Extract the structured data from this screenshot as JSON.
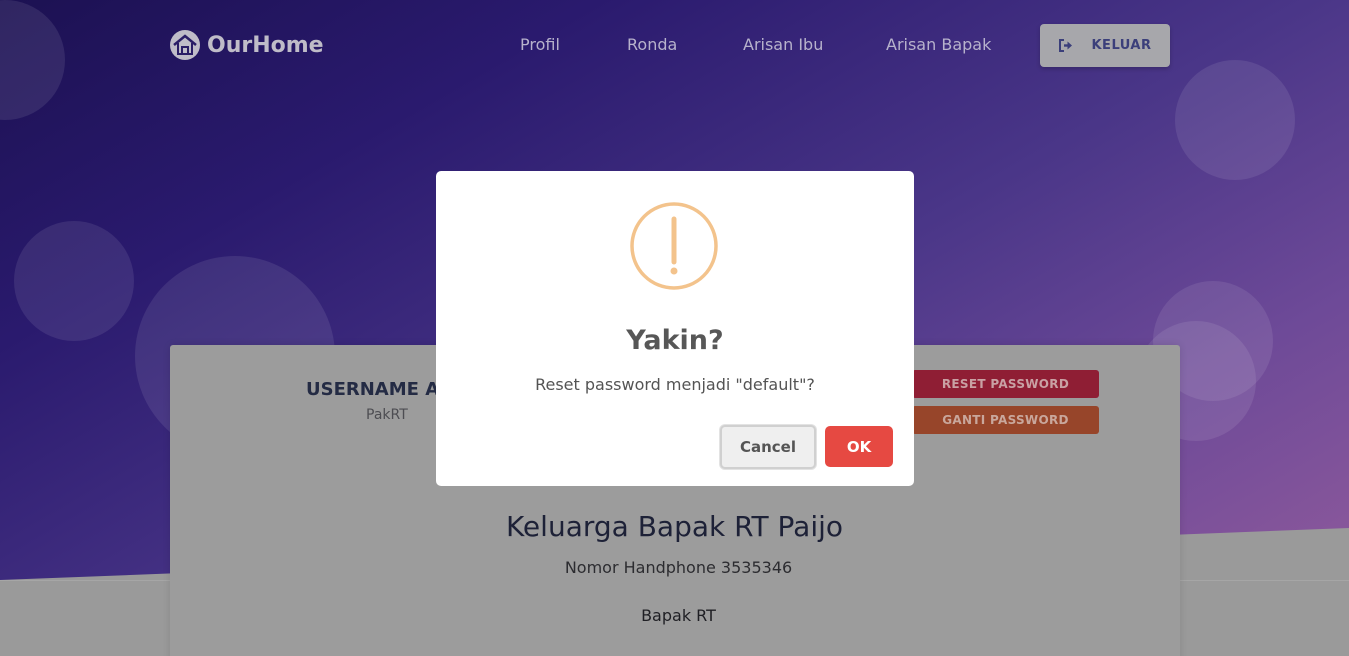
{
  "navbar": {
    "brand": "OurHome",
    "links": [
      "Profil",
      "Ronda",
      "Arisan Ibu",
      "Arisan Bapak"
    ],
    "logout_label": "KELUAR"
  },
  "profile": {
    "username_title": "USERNAME AKUN",
    "username_value": "PakRT",
    "reset_password_label": "RESET PASSWORD",
    "change_password_label": "GANTI PASSWORD",
    "family_name": "Keluarga Bapak RT Paijo",
    "phone": "Nomor Handphone 3535346",
    "role": "Bapak RT"
  },
  "dialog": {
    "icon": "warning-icon",
    "title": "Yakin?",
    "text": "Reset password menjadi \"default\"?",
    "cancel_label": "Cancel",
    "ok_label": "OK"
  },
  "colors": {
    "hero_start": "#1c1152",
    "hero_end": "#8f5a9c",
    "danger": "#e64942",
    "warning_icon": "#f3c38c"
  }
}
